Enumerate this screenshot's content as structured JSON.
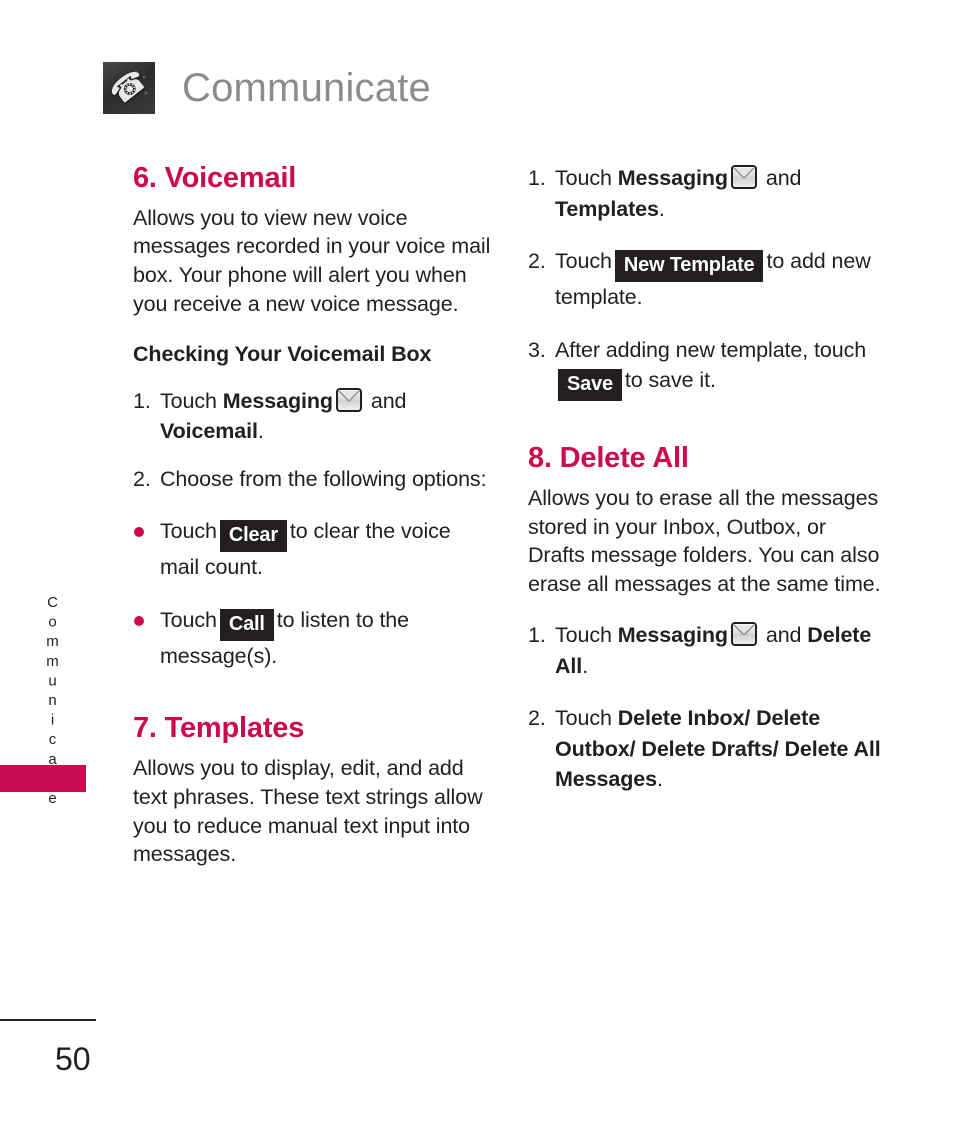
{
  "header": {
    "title": "Communicate",
    "icon": "phone-handset-icon"
  },
  "side_tab": {
    "label": "Communicate",
    "marker_color": "#c80a50"
  },
  "footer": {
    "page_number": "50"
  },
  "colors": {
    "heading_magenta": "#cc0a4e",
    "body_black": "#231f20",
    "chip_black": "#231f20",
    "header_gray": "#8c8c8c"
  },
  "left_column": {
    "section": {
      "heading": "6. Voicemail",
      "intro": "Allows you to view new voice messages recorded in your voice mail box. Your phone will alert you when you receive a new voice message.",
      "sub_heading": "Checking Your Voicemail Box",
      "steps": [
        {
          "number": "1.",
          "pre": "Touch ",
          "bold_1": "Messaging",
          "icon": "envelope-icon",
          "mid": " and ",
          "bold_2": "Voicemail",
          "post": "."
        },
        {
          "number": "2.",
          "pre": "Choose from the following options:",
          "bold_1": "",
          "mid": "",
          "bold_2": "",
          "post": ""
        }
      ],
      "bullets": [
        {
          "pre": "Touch",
          "chip": "Clear",
          "post": "to clear the voice mail count."
        },
        {
          "pre": "Touch",
          "chip": "Call",
          "post": "to listen to the message(s)."
        }
      ]
    },
    "section_2": {
      "heading": "7. Templates",
      "intro": "Allows you to display, edit, and add text phrases. These text strings allow you to reduce manual text input into messages."
    }
  },
  "right_column": {
    "templates_steps": [
      {
        "number": "1.",
        "pre": "Touch ",
        "bold_1": "Messaging",
        "icon": "envelope-icon",
        "mid": " and ",
        "bold_2": "Templates",
        "post": "."
      },
      {
        "number": "2.",
        "pre": "Touch",
        "chip": "New Template",
        "post": "to add new template."
      },
      {
        "number": "3.",
        "pre": "After adding new template, touch",
        "chip": "Save",
        "post": "to save it."
      }
    ],
    "section": {
      "heading": "8. Delete All",
      "intro": "Allows you to erase all the messages stored in your Inbox, Outbox, or Drafts message folders. You can also erase all messages at the same time.",
      "steps": [
        {
          "number": "1.",
          "pre": "Touch ",
          "bold_1": "Messaging",
          "icon": "envelope-icon",
          "mid": " and ",
          "bold_2": "Delete All",
          "post": "."
        },
        {
          "number": "2.",
          "pre": "Touch ",
          "bold_1": "Delete Inbox/ Delete Outbox/ Delete Drafts/ Delete All Messages",
          "post": "."
        }
      ]
    }
  }
}
